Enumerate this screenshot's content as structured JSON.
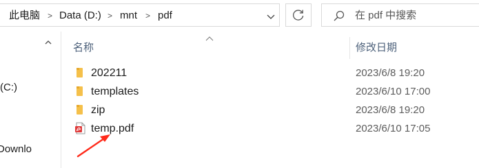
{
  "address_bar": {
    "breadcrumbs": [
      "此电脑",
      "Data (D:)",
      "mnt",
      "pdf"
    ]
  },
  "search": {
    "placeholder": "在 pdf 中搜索"
  },
  "nav_pane": {
    "items": [
      {
        "label": "(C:)"
      },
      {
        "label": "Downlo"
      }
    ]
  },
  "file_list": {
    "columns": {
      "name": "名称",
      "date_modified": "修改日期"
    },
    "rows": [
      {
        "name": "202211",
        "date": "2023/6/8 19:20",
        "icon": "folder-icon"
      },
      {
        "name": "templates",
        "date": "2023/6/10 17:00",
        "icon": "folder-icon"
      },
      {
        "name": "zip",
        "date": "2023/6/8 19:20",
        "icon": "folder-icon"
      },
      {
        "name": "temp.pdf",
        "date": "2023/6/10 17:05",
        "icon": "pdf-file-icon"
      }
    ]
  },
  "colors": {
    "folder": "#f5c04a",
    "pdf_icon": "#e03a3a",
    "annotation_arrow": "#ff2a1a",
    "header_text": "#4c607a"
  }
}
